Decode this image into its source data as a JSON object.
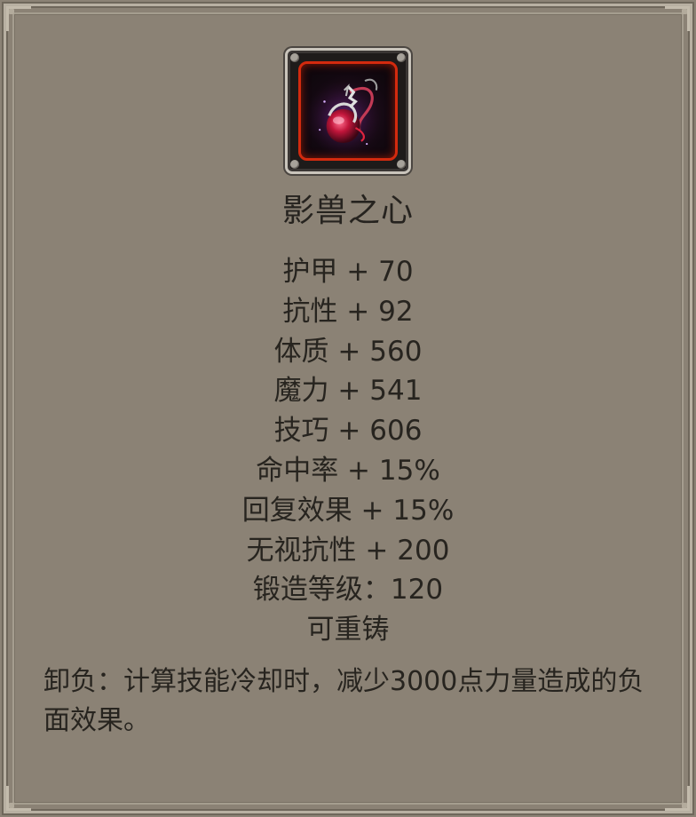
{
  "item": {
    "icon": "dark-beast-heart-icon",
    "name": "影兽之心"
  },
  "stats": [
    "护甲 + 70",
    "抗性 + 92",
    "体质 + 560",
    "魔力 + 541",
    "技巧 + 606",
    "命中率 + 15%",
    "回复效果 + 15%",
    "无视抗性 + 200",
    "锻造等级：120",
    "可重铸"
  ],
  "description": "卸负：计算技能冷却时，减少3000点力量造成的负面效果。",
  "colors": {
    "panel_background": "#8b8275",
    "text": "#27241f",
    "icon_border_accent": "#d32a0e"
  }
}
